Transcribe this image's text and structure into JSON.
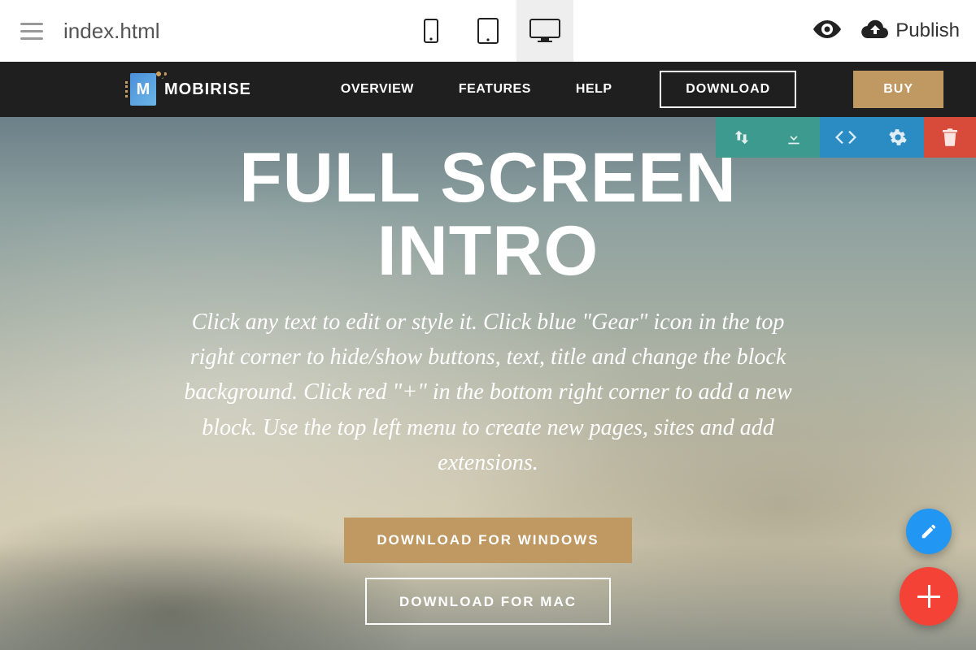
{
  "app": {
    "filename": "index.html",
    "publish": "Publish"
  },
  "nav": {
    "brand": "MOBIRISE",
    "links": [
      "OVERVIEW",
      "FEATURES",
      "HELP"
    ],
    "download": "DOWNLOAD",
    "buy": "BUY"
  },
  "hero": {
    "title_l1": "FULL SCREEN",
    "title_l2": "INTRO",
    "subtitle": "Click any text to edit or style it. Click blue \"Gear\" icon in the top right corner to hide/show buttons, text, title and change the block background. Click red \"+\" in the bottom right corner to add a new block. Use the top left menu to create new pages, sites and add extensions.",
    "btn_win": "DOWNLOAD FOR WINDOWS",
    "btn_mac": "DOWNLOAD FOR MAC"
  }
}
